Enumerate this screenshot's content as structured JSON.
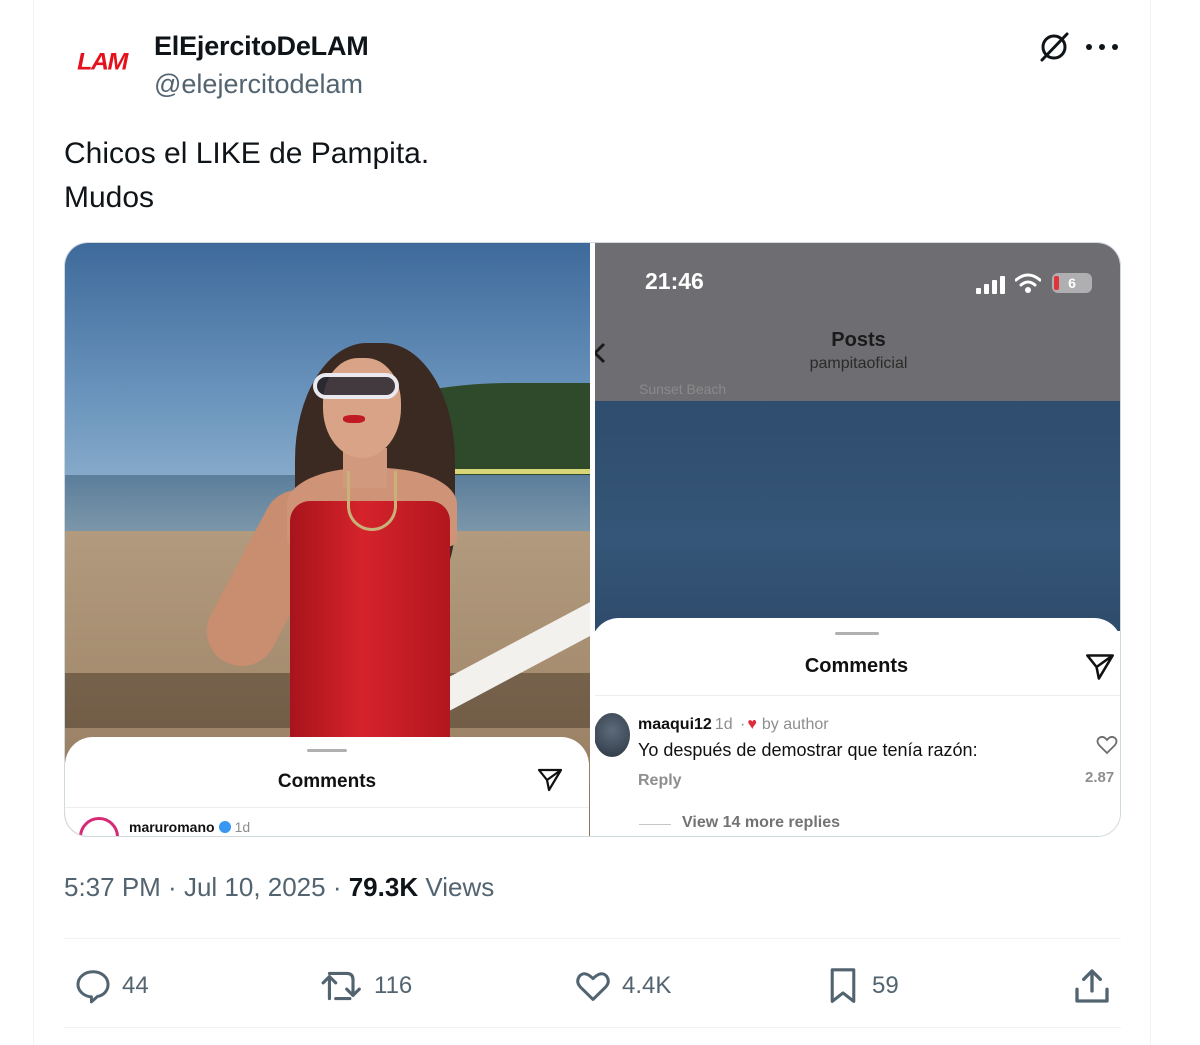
{
  "author": {
    "display_name": "ElEjercitoDeLAM",
    "handle": "@elejercitodelam",
    "avatar_logo_text": "LAM"
  },
  "tweet": {
    "text_lines": [
      "Chicos el LIKE de Pampita.",
      "Mudos"
    ],
    "time": "5:37 PM",
    "date": "Jul 10, 2025",
    "views_count": "79.3K",
    "views_label": "Views"
  },
  "media_left": {
    "sheet_title": "Comments",
    "comment_user": "maruromano",
    "comment_time": "1d"
  },
  "media_right": {
    "status_time": "21:46",
    "battery": "6",
    "header_title": "Posts",
    "header_subtitle": "pampitaoficial",
    "ghost_text": "Sunset Beach",
    "sheet_title": "Comments",
    "reply_user": "maaqui12",
    "reply_time": "1d",
    "reply_liked_by": "by author",
    "reply_text": "Yo después de demostrar que tenía razón:",
    "reply_link": "Reply",
    "like_count": "2.87",
    "more_replies": "View 14 more replies"
  },
  "actions": {
    "replies": "44",
    "reposts": "116",
    "likes": "4.4K",
    "bookmarks": "59"
  },
  "colors": {
    "accent_red": "#e3121b",
    "text_primary": "#0f1419",
    "text_secondary": "#536471",
    "border": "#cfd9de"
  }
}
